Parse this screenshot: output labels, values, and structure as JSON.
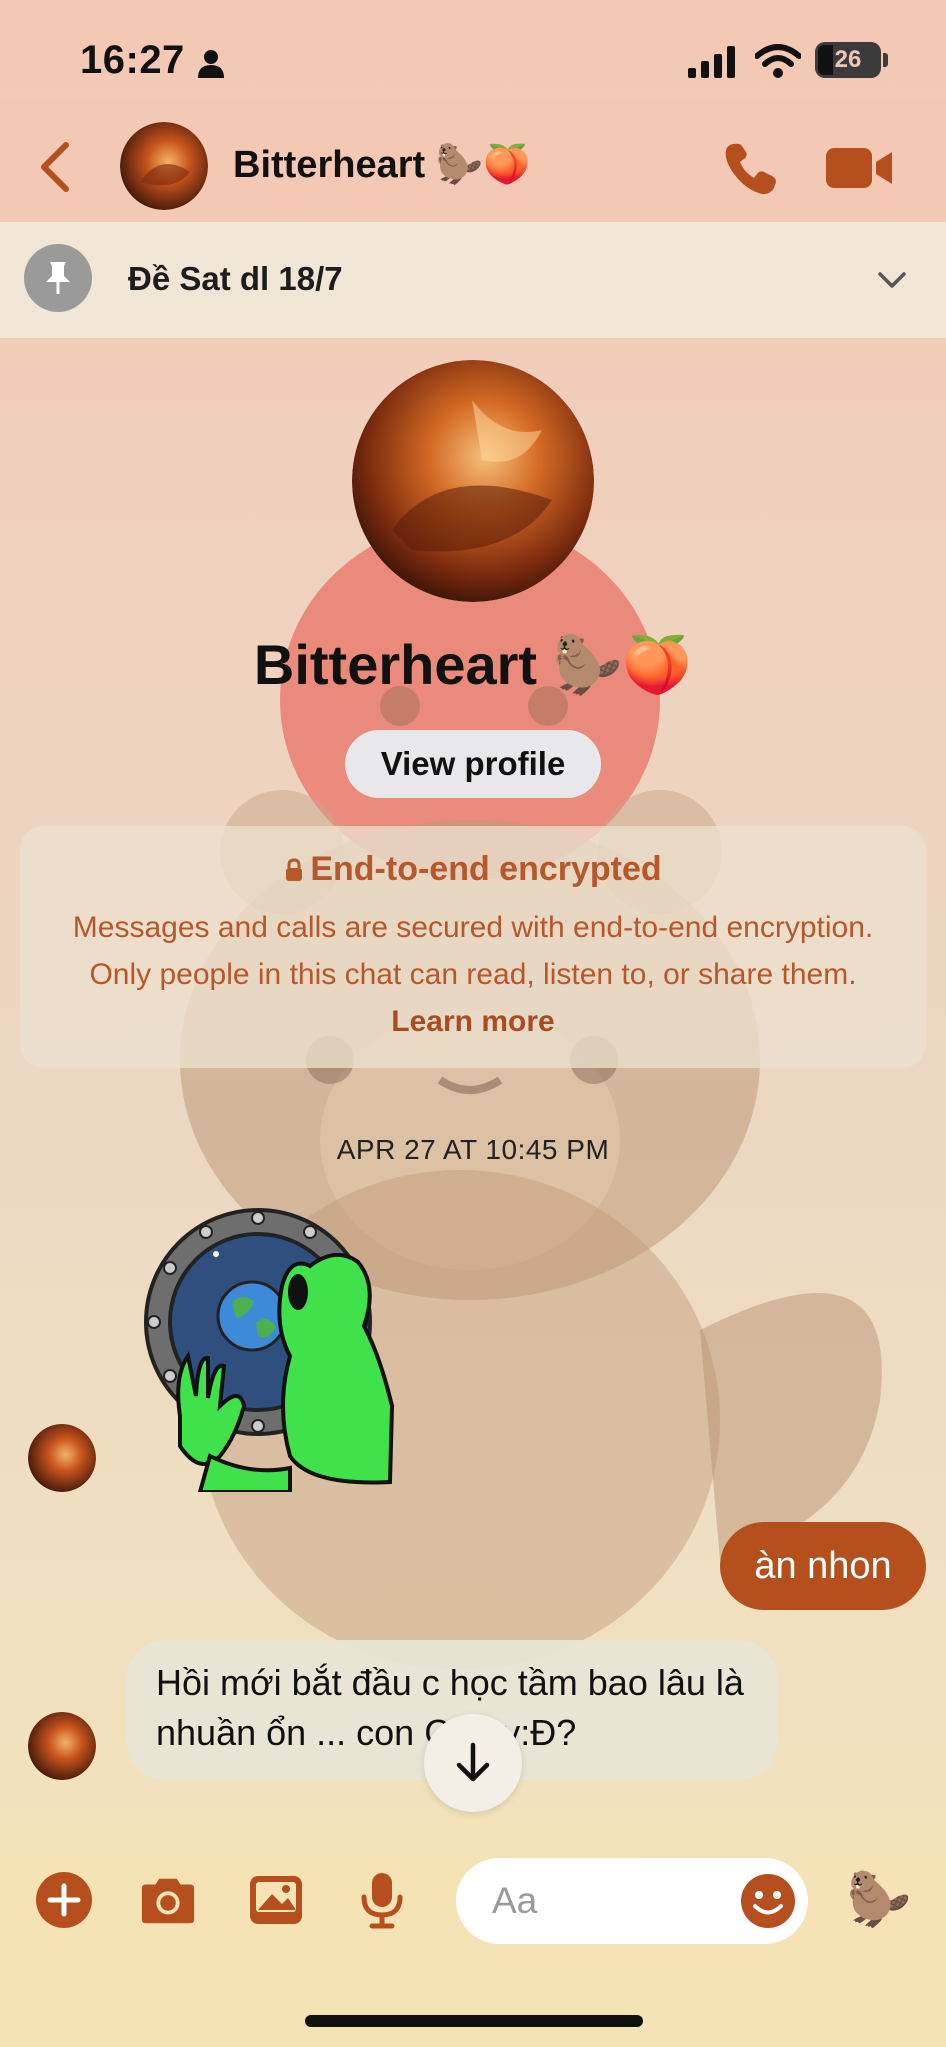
{
  "status_bar": {
    "time": "16:27",
    "battery_level": "26"
  },
  "header": {
    "contact_name": "Bitterheart",
    "name_emoji": "🦫🍑",
    "back_icon": "chevron-left-icon",
    "call_icon": "phone-icon",
    "video_icon": "video-camera-icon"
  },
  "pinned": {
    "text": "Đề Sat dl 18/7",
    "icon": "pin-icon"
  },
  "profile": {
    "name": "Bitterheart",
    "name_emoji": "🦫🍑",
    "view_profile_label": "View profile"
  },
  "encryption": {
    "title": "End-to-end encrypted",
    "body": "Messages and calls are secured with end-to-end encryption. Only people in this chat can read, listen to, or share them.",
    "link": "Learn more"
  },
  "conversation": {
    "timestamp": "APR 27 AT 10:45 PM",
    "messages": [
      {
        "direction": "incoming",
        "type": "sticker",
        "sticker": "alien-holding-earth-porthole"
      },
      {
        "direction": "outgoing",
        "type": "text",
        "text": "àn nhon"
      },
      {
        "direction": "incoming",
        "type": "text",
        "text": "Hồi mới bắt đầu c học tầm bao lâu là nhuần ổn ... con C++ v:Đ?"
      }
    ]
  },
  "composer": {
    "placeholder": "Aa",
    "icons": [
      "plus-circle-icon",
      "camera-icon",
      "image-icon",
      "microphone-icon",
      "smiley-icon",
      "beaver-sticker-icon"
    ],
    "quick_reaction": "🦫"
  },
  "colors": {
    "accent": "#b5501e",
    "header_bg": "#f3c8b4",
    "pinned_bg": "#efe6d6",
    "encryption_text": "#b5582a"
  }
}
